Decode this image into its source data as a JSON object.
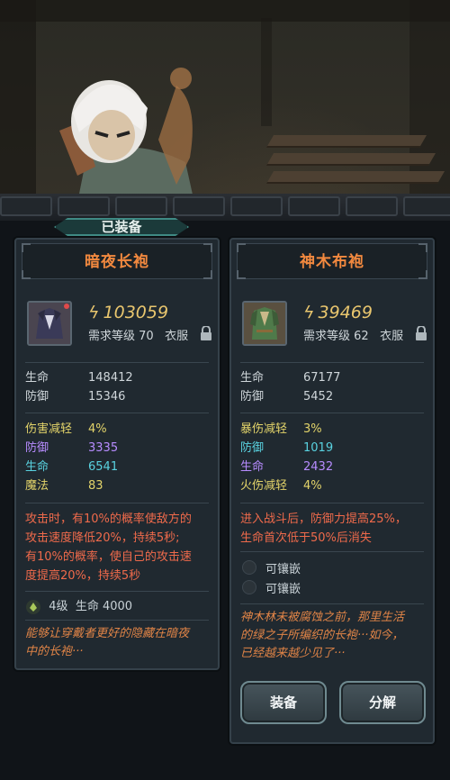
{
  "equipped_tag": "已装备",
  "colors": {
    "title": "#f2893f",
    "power": "#e9c66e",
    "yellow": "#e3d46a",
    "purple": "#b78cff",
    "cyan": "#59d2e0",
    "desc": "#ef6a4b"
  },
  "left": {
    "name": "暗夜长袍",
    "power": "103059",
    "req": "需求等级 70",
    "slot": "衣服",
    "base_stats": [
      {
        "k": "生命",
        "v": "148412"
      },
      {
        "k": "防御",
        "v": "15346"
      }
    ],
    "extra_stats": [
      {
        "k": "伤害减轻",
        "v": "4%",
        "color": "yellow"
      },
      {
        "k": "防御",
        "v": "3335",
        "color": "purple"
      },
      {
        "k": "生命",
        "v": "6541",
        "color": "cyan"
      },
      {
        "k": "魔法",
        "v": "83",
        "color": "yellow"
      }
    ],
    "effect_lines": [
      "攻击时，有10%的概率使敌方的",
      "攻击速度降低20%，持续5秒;",
      "有10%的概率，使自己的攻击速",
      "度提高20%，持续5秒"
    ],
    "gem": {
      "level": "4级",
      "stat": "生命 4000"
    },
    "lore_lines": [
      "能够让穿戴者更好的隐藏在暗夜",
      "中的长袍···"
    ]
  },
  "right": {
    "name": "神木布袍",
    "power": "39469",
    "req": "需求等级 62",
    "slot": "衣服",
    "base_stats": [
      {
        "k": "生命",
        "v": "67177"
      },
      {
        "k": "防御",
        "v": "5452"
      }
    ],
    "extra_stats": [
      {
        "k": "暴伤减轻",
        "v": "3%",
        "color": "yellow"
      },
      {
        "k": "防御",
        "v": "1019",
        "color": "cyan"
      },
      {
        "k": "生命",
        "v": "2432",
        "color": "purple"
      },
      {
        "k": "火伤减轻",
        "v": "4%",
        "color": "yellow"
      }
    ],
    "effect_lines": [
      "进入战斗后，防御力提高25%，",
      "生命首次低于50%后消失"
    ],
    "sockets": [
      "可镶嵌",
      "可镶嵌"
    ],
    "lore_lines": [
      "神木林未被腐蚀之前，那里生活",
      "的绿之子所编织的长袍···如今，",
      "已经越来越少见了···"
    ],
    "buttons": {
      "equip": "装备",
      "decompose": "分解"
    }
  }
}
